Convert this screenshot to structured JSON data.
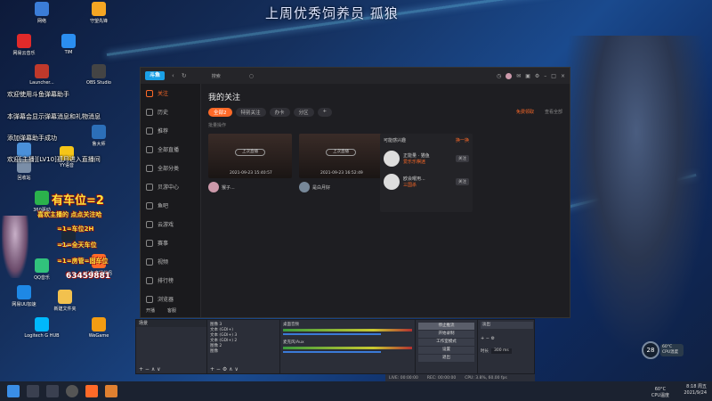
{
  "banner": "上周优秀饲养员 孤狼",
  "desktop_icons": [
    {
      "label": "网络",
      "color": "#3b7dd8"
    },
    {
      "label": "守望先锋",
      "color": "#f5a623"
    },
    {
      "label": "网易云音乐",
      "color": "#e02a2a"
    },
    {
      "label": "TIM",
      "color": "#2b8ef0"
    },
    {
      "label": "Launcher...",
      "color": "#c0392b"
    },
    {
      "label": "OBS Studio",
      "color": "#444444"
    },
    {
      "label": "此电脑",
      "color": "#4a90d9"
    },
    {
      "label": "鲁大师",
      "color": "#2c6fb8"
    },
    {
      "label": "回收站",
      "color": "#7a8ea8"
    },
    {
      "label": "YY语音",
      "color": "#f5c518"
    },
    {
      "label": "360驱动",
      "color": "#2bb24c"
    },
    {
      "label": "Steam",
      "color": "#1b2838"
    },
    {
      "label": "QQ音乐",
      "color": "#31c27c"
    },
    {
      "label": "斗鱼直播伴侣",
      "color": "#ff6a28"
    },
    {
      "label": "网易UU加速",
      "color": "#1e88e5"
    },
    {
      "label": "新建文件夹",
      "color": "#f2c14e"
    },
    {
      "label": "Logitech G HUB",
      "color": "#00b8fc"
    },
    {
      "label": "WeGame",
      "color": "#f39c12"
    }
  ],
  "overlay_lines": [
    "欢迎使用斗鱼弹幕助手",
    "本弹幕会显示弹幕消息和礼物消息",
    "添加弹幕助手成功",
    "欢迎[主播][LV10]孤月进入直播间"
  ],
  "promo": {
    "title": "有车位=2",
    "subtitle": "喜欢主播的 点点关注哈",
    "items": [
      "=1=车位2H",
      "=1=全天车位",
      "=1=房管=固车位"
    ],
    "qq": "63459881"
  },
  "douyu": {
    "search_placeholder": "搜索",
    "sidebar": [
      {
        "label": "关注",
        "active": true
      },
      {
        "label": "历史"
      },
      {
        "label": "推荐"
      },
      {
        "label": "全部直播"
      },
      {
        "label": "全部分类"
      },
      {
        "label": "贝游中心"
      },
      {
        "label": "鱼吧"
      },
      {
        "label": "云游戏"
      },
      {
        "label": "赛事"
      },
      {
        "label": "视频"
      },
      {
        "label": "排行榜"
      },
      {
        "label": "浏览器"
      }
    ],
    "sidebar_footer": [
      "开播",
      "客服"
    ],
    "title": "我的关注",
    "chips": [
      {
        "label": "全部2",
        "active": true
      },
      {
        "label": "特别关注"
      },
      {
        "label": "办卡"
      },
      {
        "label": "分区"
      }
    ],
    "sub": "批量操作",
    "right_links": [
      "免费领取",
      "查看全部"
    ],
    "cards": [
      {
        "overlay": "上次直播",
        "time": "2021-09-23 15:40:57",
        "name": "猴子..."
      },
      {
        "overlay": "上次直播",
        "time": "2021-09-23 16:52:49",
        "name": "是白月好"
      }
    ],
    "rec_title": "可能感兴趣",
    "rec_link": "换一换",
    "recs": [
      {
        "name": "正能量 · 猫鱼",
        "tag": "爱乐乐棋迷",
        "btn": "关注"
      },
      {
        "name": "欧会曜用...",
        "tag": "三国杀",
        "btn": "关注"
      }
    ]
  },
  "obs": {
    "scene_header": "场景",
    "sources": [
      "图像 3",
      "文本 (GDI+)",
      "文本 (GDI+) 3",
      "文本 (GDI+) 2",
      "图像 2",
      "图像"
    ],
    "mix_header": "混音器",
    "mixer": [
      "桌面音频",
      "麦克风/Aux"
    ],
    "controls": [
      "停止推流",
      "开始录制",
      "工作室模式",
      "设置",
      "退出"
    ],
    "trans_header": "淡出",
    "duration_label": "时长",
    "duration_value": "300 ms",
    "status": [
      "LIVE: 00:00:00",
      "REC: 00:00:00",
      "CPU: 3.8%, 60.00 fps"
    ]
  },
  "taskbar": {
    "temp": "60°C",
    "temp_label": "CPU温度",
    "time": "8:18 周五",
    "date": "2021/9/24"
  },
  "gauge": {
    "value": "28",
    "unit": "%",
    "info1": "60°C",
    "info2": "CPU温度"
  }
}
